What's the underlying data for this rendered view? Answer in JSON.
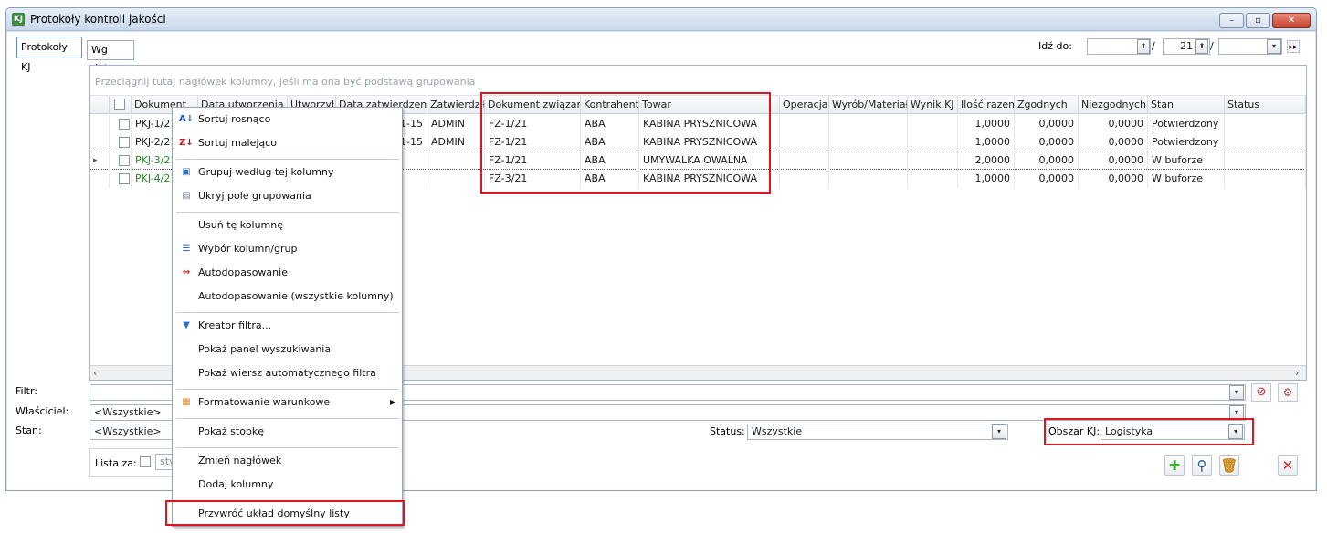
{
  "window": {
    "title": "Protokoły kontroli jakości",
    "app_icon_letter": "KJ",
    "controls": {
      "minimize": "–",
      "maximize": "▫",
      "close": "✕"
    }
  },
  "tabs": [
    {
      "label": "Protokoły KJ"
    },
    {
      "label": "Wg daty"
    }
  ],
  "goto": {
    "label": "Idź do:",
    "year_value": "21",
    "month_value": ""
  },
  "grid": {
    "group_hint": "Przeciągnij tutaj nagłówek kolumny, jeśli ma ona być podstawą grupowania",
    "columns": [
      "Dokument",
      "Data utworzenia",
      "Utworzył",
      "Data zatwierdzenia",
      "Zatwierdził",
      "Dokument związany",
      "Kontrahent",
      "Towar",
      "Operacja",
      "Wyrób/Materiał",
      "Wynik KJ",
      "Ilość razem",
      "Zgodnych",
      "Niezgodnych",
      "Stan",
      "Status"
    ],
    "rows": [
      {
        "doc": "PKJ-1/21",
        "date_approved": "1-15",
        "approver": "ADMIN",
        "related": "FZ-1/21",
        "contractor": "ABA",
        "item": "KABINA PRYSZNICOWA",
        "total": "1,0000",
        "ok": "0,0000",
        "nok": "0,0000",
        "state": "Potwierdzony",
        "green": false
      },
      {
        "doc": "PKJ-2/21",
        "date_approved": "1-15",
        "approver": "ADMIN",
        "related": "FZ-1/21",
        "contractor": "ABA",
        "item": "KABINA PRYSZNICOWA",
        "total": "1,0000",
        "ok": "0,0000",
        "nok": "0,0000",
        "state": "Potwierdzony",
        "green": false
      },
      {
        "doc": "PKJ-3/21",
        "date_approved": "",
        "approver": "",
        "related": "FZ-1/21",
        "contractor": "ABA",
        "item": "UMYWALKA OWALNA",
        "total": "2,0000",
        "ok": "0,0000",
        "nok": "0,0000",
        "state": "W buforze",
        "green": true
      },
      {
        "doc": "PKJ-4/21",
        "date_approved": "",
        "approver": "",
        "related": "FZ-3/21",
        "contractor": "ABA",
        "item": "KABINA PRYSZNICOWA",
        "total": "1,0000",
        "ok": "0,0000",
        "nok": "0,0000",
        "state": "W buforze",
        "green": true
      }
    ]
  },
  "filters": {
    "filter_label": "Filtr:",
    "owner_label": "Właściciel:",
    "owner_value": "<Wszystkie>",
    "state_label": "Stan:",
    "state_value": "<Wszystkie>",
    "status_label": "Status:",
    "status_value": "Wszystkie",
    "area_label": "Obszar KJ:",
    "area_value": "Logistyka",
    "list_for_label": "Lista za:",
    "list_for_value": "sty"
  },
  "context_menu": [
    {
      "label": "Sortuj rosnąco",
      "icon": "sort-ascending-icon"
    },
    {
      "label": "Sortuj malejąco",
      "icon": "sort-descending-icon"
    },
    {
      "label": "Grupuj według tej kolumny",
      "icon": "group-by-icon"
    },
    {
      "label": "Ukryj pole grupowania",
      "icon": "hide-group-panel-icon"
    },
    {
      "label": "Usuń tę kolumnę",
      "icon": ""
    },
    {
      "label": "Wybór kolumn/grup",
      "icon": "column-chooser-icon"
    },
    {
      "label": "Autodopasowanie",
      "icon": "autofit-icon"
    },
    {
      "label": "Autodopasowanie (wszystkie kolumny)",
      "icon": ""
    },
    {
      "label": "Kreator filtra...",
      "icon": "filter-icon"
    },
    {
      "label": "Pokaż panel wyszukiwania",
      "icon": ""
    },
    {
      "label": "Pokaż wiersz automatycznego filtra",
      "icon": ""
    },
    {
      "label": "Formatowanie warunkowe",
      "icon": "conditional-format-icon"
    },
    {
      "label": "Pokaż stopkę",
      "icon": ""
    },
    {
      "label": "Zmień nagłówek",
      "icon": ""
    },
    {
      "label": "Dodaj kolumny",
      "icon": ""
    },
    {
      "label": "Przywróć układ domyślny listy",
      "icon": ""
    }
  ],
  "colors": {
    "highlight": "#e0141e",
    "in_buffer_row": "#1c8c1c",
    "add_button": "#3cab2b",
    "delete_button": "#d6262a"
  }
}
